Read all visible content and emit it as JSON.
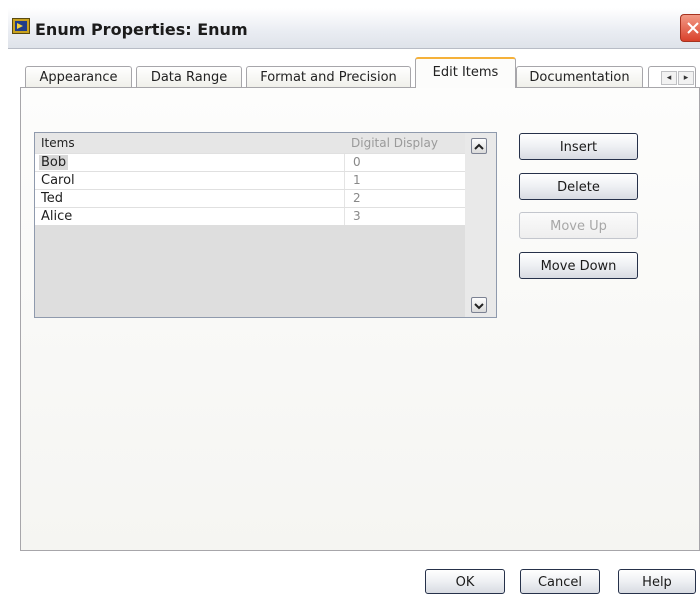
{
  "window": {
    "title": "Enum Properties: Enum"
  },
  "tabs": [
    {
      "label": "Appearance",
      "active": false
    },
    {
      "label": "Data Range",
      "active": false
    },
    {
      "label": "Format and Precision",
      "active": false
    },
    {
      "label": "Edit Items",
      "active": true
    },
    {
      "label": "Documentation",
      "active": false
    }
  ],
  "table": {
    "headers": {
      "items": "Items",
      "value": "Digital Display"
    },
    "rows": [
      {
        "name": "Bob",
        "value": "0",
        "selected": true
      },
      {
        "name": "Carol",
        "value": "1",
        "selected": false
      },
      {
        "name": "Ted",
        "value": "2",
        "selected": false
      },
      {
        "name": "Alice",
        "value": "3",
        "selected": false
      }
    ]
  },
  "side_buttons": {
    "insert": "Insert",
    "delete": "Delete",
    "move_up": "Move Up",
    "move_down": "Move Down"
  },
  "footer": {
    "ok": "OK",
    "cancel": "Cancel",
    "help": "Help"
  },
  "icons": {
    "app": "labview-enum-icon",
    "close": "close-icon",
    "tab_left": "chevron-left-icon",
    "tab_right": "chevron-right-icon",
    "scroll_up": "chevron-up-icon",
    "scroll_down": "chevron-down-icon"
  }
}
